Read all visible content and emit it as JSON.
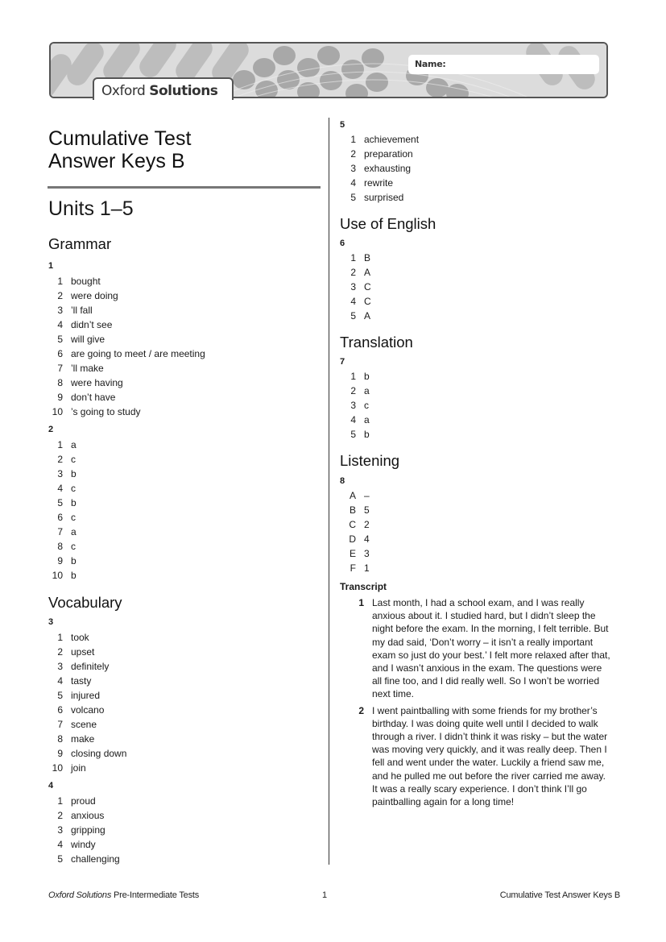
{
  "header": {
    "brand_light": "Oxford",
    "brand_bold": "Solutions",
    "name_label": "Name:"
  },
  "document": {
    "title_line1": "Cumulative Test",
    "title_line2": "Answer Keys B",
    "units": "Units 1–5"
  },
  "sections": {
    "grammar": {
      "title": "Grammar",
      "exercises": [
        {
          "number": "1",
          "answers": [
            {
              "n": "1",
              "v": "bought"
            },
            {
              "n": "2",
              "v": "were doing"
            },
            {
              "n": "3",
              "v": "’ll fall"
            },
            {
              "n": "4",
              "v": "didn’t see"
            },
            {
              "n": "5",
              "v": "will give"
            },
            {
              "n": "6",
              "v": "are going to meet / are meeting"
            },
            {
              "n": "7",
              "v": "’ll make"
            },
            {
              "n": "8",
              "v": "were having"
            },
            {
              "n": "9",
              "v": "don’t have"
            },
            {
              "n": "10",
              "v": "’s going to study"
            }
          ]
        },
        {
          "number": "2",
          "answers": [
            {
              "n": "1",
              "v": "a"
            },
            {
              "n": "2",
              "v": "c"
            },
            {
              "n": "3",
              "v": "b"
            },
            {
              "n": "4",
              "v": "c"
            },
            {
              "n": "5",
              "v": "b"
            },
            {
              "n": "6",
              "v": "c"
            },
            {
              "n": "7",
              "v": "a"
            },
            {
              "n": "8",
              "v": "c"
            },
            {
              "n": "9",
              "v": "b"
            },
            {
              "n": "10",
              "v": "b"
            }
          ]
        }
      ]
    },
    "vocabulary": {
      "title": "Vocabulary",
      "exercises": [
        {
          "number": "3",
          "answers": [
            {
              "n": "1",
              "v": "took"
            },
            {
              "n": "2",
              "v": "upset"
            },
            {
              "n": "3",
              "v": "definitely"
            },
            {
              "n": "4",
              "v": "tasty"
            },
            {
              "n": "5",
              "v": "injured"
            },
            {
              "n": "6",
              "v": "volcano"
            },
            {
              "n": "7",
              "v": "scene"
            },
            {
              "n": "8",
              "v": "make"
            },
            {
              "n": "9",
              "v": "closing down"
            },
            {
              "n": "10",
              "v": "join"
            }
          ]
        },
        {
          "number": "4",
          "answers": [
            {
              "n": "1",
              "v": "proud"
            },
            {
              "n": "2",
              "v": "anxious"
            },
            {
              "n": "3",
              "v": "gripping"
            },
            {
              "n": "4",
              "v": "windy"
            },
            {
              "n": "5",
              "v": "challenging"
            }
          ]
        },
        {
          "number": "5",
          "answers": [
            {
              "n": "1",
              "v": "achievement"
            },
            {
              "n": "2",
              "v": "preparation"
            },
            {
              "n": "3",
              "v": "exhausting"
            },
            {
              "n": "4",
              "v": "rewrite"
            },
            {
              "n": "5",
              "v": "surprised"
            }
          ]
        }
      ]
    },
    "use_of_english": {
      "title": "Use of English",
      "exercises": [
        {
          "number": "6",
          "answers": [
            {
              "n": "1",
              "v": "B"
            },
            {
              "n": "2",
              "v": "A"
            },
            {
              "n": "3",
              "v": "C"
            },
            {
              "n": "4",
              "v": "C"
            },
            {
              "n": "5",
              "v": "A"
            }
          ]
        }
      ]
    },
    "translation": {
      "title": "Translation",
      "exercises": [
        {
          "number": "7",
          "answers": [
            {
              "n": "1",
              "v": "b"
            },
            {
              "n": "2",
              "v": "a"
            },
            {
              "n": "3",
              "v": "c"
            },
            {
              "n": "4",
              "v": "a"
            },
            {
              "n": "5",
              "v": "b"
            }
          ]
        }
      ]
    },
    "listening": {
      "title": "Listening",
      "exercises": [
        {
          "number": "8",
          "answers": [
            {
              "n": "A",
              "v": "–"
            },
            {
              "n": "B",
              "v": "5"
            },
            {
              "n": "C",
              "v": "2"
            },
            {
              "n": "D",
              "v": "4"
            },
            {
              "n": "E",
              "v": "3"
            },
            {
              "n": "F",
              "v": "1"
            }
          ]
        }
      ],
      "transcript_label": "Transcript",
      "transcript": [
        {
          "n": "1",
          "text": "Last month, I had a school exam, and I was really anxious about it. I studied hard, but I didn’t sleep the night before the exam. In the morning, I felt terrible. But my dad said, ‘Don’t worry – it isn’t a really important exam so just do your best.’ I felt more relaxed after that, and I wasn’t anxious in the exam. The questions were all fine too, and I did really well. So I won’t be worried next time."
        },
        {
          "n": "2",
          "text": "I went paintballing with some friends for my brother’s birthday. I was doing quite well until I decided to walk through a river. I didn’t think it was risky – but the water was moving very quickly, and it was really deep. Then I fell and went under the water. Luckily a friend saw me, and he pulled me out before the river carried me away. It was a really scary experience. I don’t think I’ll go paintballing again for a long time!"
        }
      ]
    }
  },
  "footer": {
    "left_italic": "Oxford Solutions",
    "left_rest": " Pre-Intermediate Tests",
    "page_number": "1",
    "right": "Cumulative Test Answer Keys B"
  }
}
